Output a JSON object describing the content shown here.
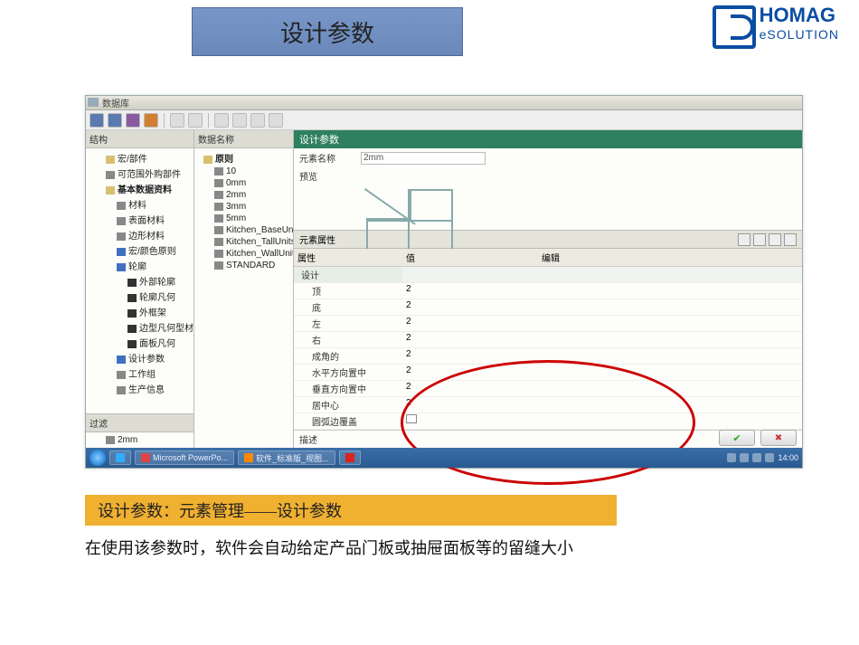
{
  "banner_title": "设计参数",
  "logo": {
    "brand": "HOMAG",
    "sub": "eSOLUTION"
  },
  "window_title": "数据库",
  "columns": {
    "col1_header": "结构",
    "col2_header": "数据名称",
    "col1_items": [
      {
        "depth": 2,
        "icon": "folder",
        "label": "宏/部件"
      },
      {
        "depth": 2,
        "icon": "grey",
        "label": "可范围外购部件"
      },
      {
        "depth": 2,
        "icon": "folder",
        "label": "基本数据资料",
        "bold": true
      },
      {
        "depth": 3,
        "icon": "grey",
        "label": "材料"
      },
      {
        "depth": 3,
        "icon": "grey",
        "label": "表面材料"
      },
      {
        "depth": 3,
        "icon": "grey",
        "label": "边形材料"
      },
      {
        "depth": 3,
        "icon": "blue",
        "label": "宏/颜色原则"
      },
      {
        "depth": 3,
        "icon": "blue",
        "label": "轮廓"
      },
      {
        "depth": 4,
        "icon": "sq",
        "label": "外部轮廓"
      },
      {
        "depth": 4,
        "icon": "sq",
        "label": "轮廓凡何"
      },
      {
        "depth": 4,
        "icon": "sq",
        "label": "外框架"
      },
      {
        "depth": 4,
        "icon": "sq",
        "label": "边型凡何型材"
      },
      {
        "depth": 4,
        "icon": "sq",
        "label": "面板凡何"
      },
      {
        "depth": 3,
        "icon": "blue",
        "label": "设计参数"
      },
      {
        "depth": 3,
        "icon": "grey",
        "label": "工作组"
      },
      {
        "depth": 3,
        "icon": "grey",
        "label": "生产信息"
      }
    ],
    "col1_bottom_header": "过滤",
    "col1_bottom_item": "2mm",
    "col2_items": [
      {
        "label": "原则",
        "bold": true
      },
      {
        "label": "10"
      },
      {
        "label": "0mm"
      },
      {
        "label": "2mm"
      },
      {
        "label": "3mm"
      },
      {
        "label": "5mm"
      },
      {
        "label": "Kitchen_BaseUnits"
      },
      {
        "label": "Kitchen_TallUnits"
      },
      {
        "label": "Kitchen_WallUnits"
      },
      {
        "label": "STANDARD"
      }
    ]
  },
  "panel": {
    "title": "设计参数",
    "name_label": "元素名称",
    "name_value": "2mm",
    "preview_label": "预览"
  },
  "props": {
    "header": "元素属性",
    "th": {
      "c1": "属性",
      "c2": "值",
      "c3": "编辑"
    },
    "rows": [
      {
        "group": true,
        "c1": "设计",
        "c2": "",
        "c3": ""
      },
      {
        "c1": "顶",
        "c2": "2",
        "c3": ""
      },
      {
        "c1": "底",
        "c2": "2",
        "c3": ""
      },
      {
        "c1": "左",
        "c2": "2",
        "c3": ""
      },
      {
        "c1": "右",
        "c2": "2",
        "c3": ""
      },
      {
        "c1": "成角的",
        "c2": "2",
        "c3": ""
      },
      {
        "c1": "水平方向置中",
        "c2": "2",
        "c3": ""
      },
      {
        "c1": "垂直方向置中",
        "c2": "2",
        "c3": ""
      },
      {
        "c1": "居中心",
        "c2": "2",
        "c3": ""
      },
      {
        "c1": "圆弧边覆盖",
        "c2": "",
        "c3": "checkbox"
      }
    ],
    "desc_label": "描述"
  },
  "taskbar": {
    "items": [
      {
        "cls": "ie",
        "label": ""
      },
      {
        "cls": "pp",
        "label": "Microsoft PowerPo..."
      },
      {
        "cls": "",
        "label": "软件_标准版_视图..."
      },
      {
        "cls": "pdf",
        "label": ""
      }
    ],
    "time": "14:00"
  },
  "caption_bar": "设计参数：元素管理——设计参数",
  "caption_text": "在使用该参数时，软件会自动给定产品门板或抽屉面板等的留缝大小"
}
